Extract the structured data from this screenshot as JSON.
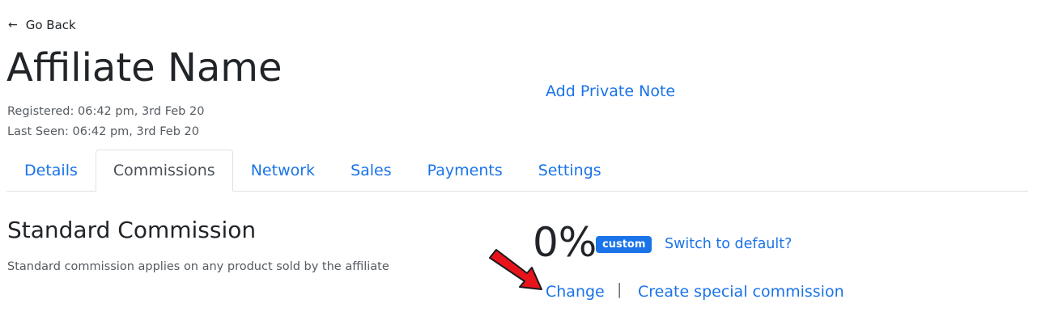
{
  "nav": {
    "back_label": "Go Back",
    "back_icon": "arrow-left-icon"
  },
  "affiliate": {
    "name": "Affiliate Name",
    "registered": "Registered: 06:42 pm, 3rd Feb 20",
    "last_seen": "Last Seen: 06:42 pm, 3rd Feb 20",
    "private_note_link": "Add Private Note"
  },
  "tabs": [
    {
      "label": "Details",
      "active": false
    },
    {
      "label": "Commissions",
      "active": true
    },
    {
      "label": "Network",
      "active": false
    },
    {
      "label": "Sales",
      "active": false
    },
    {
      "label": "Payments",
      "active": false
    },
    {
      "label": "Settings",
      "active": false
    }
  ],
  "commission": {
    "title": "Standard Commission",
    "description": "Standard commission applies on any product sold by the affiliate",
    "rate": "0%",
    "badge": "custom",
    "switch_link": "Switch to default?",
    "change_link": "Change",
    "separator": "|",
    "special_link": "Create special commission"
  },
  "colors": {
    "link": "#1a73e8",
    "badge_bg": "#1a73e8",
    "annotation_arrow": "#e8141c"
  }
}
